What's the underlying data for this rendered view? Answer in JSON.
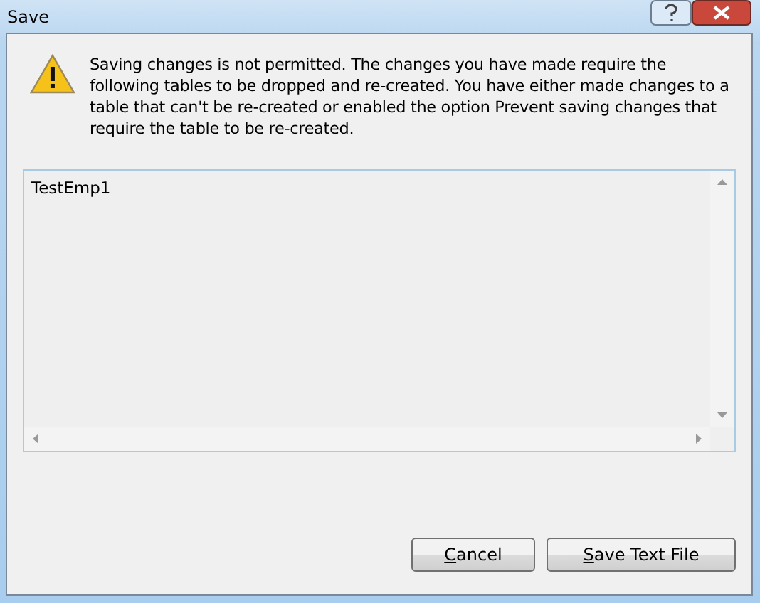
{
  "window": {
    "title": "Save"
  },
  "message": "Saving changes is not permitted. The changes you have made require the following tables to be dropped and re-created. You have either made changes to a table that can't be re-created or enabled the option Prevent saving changes that require the table to be re-created.",
  "tables_list": {
    "lines": [
      "TestEmp1"
    ]
  },
  "buttons": [
    {
      "label": "Cancel"
    },
    {
      "label": "Save Text File"
    }
  ]
}
